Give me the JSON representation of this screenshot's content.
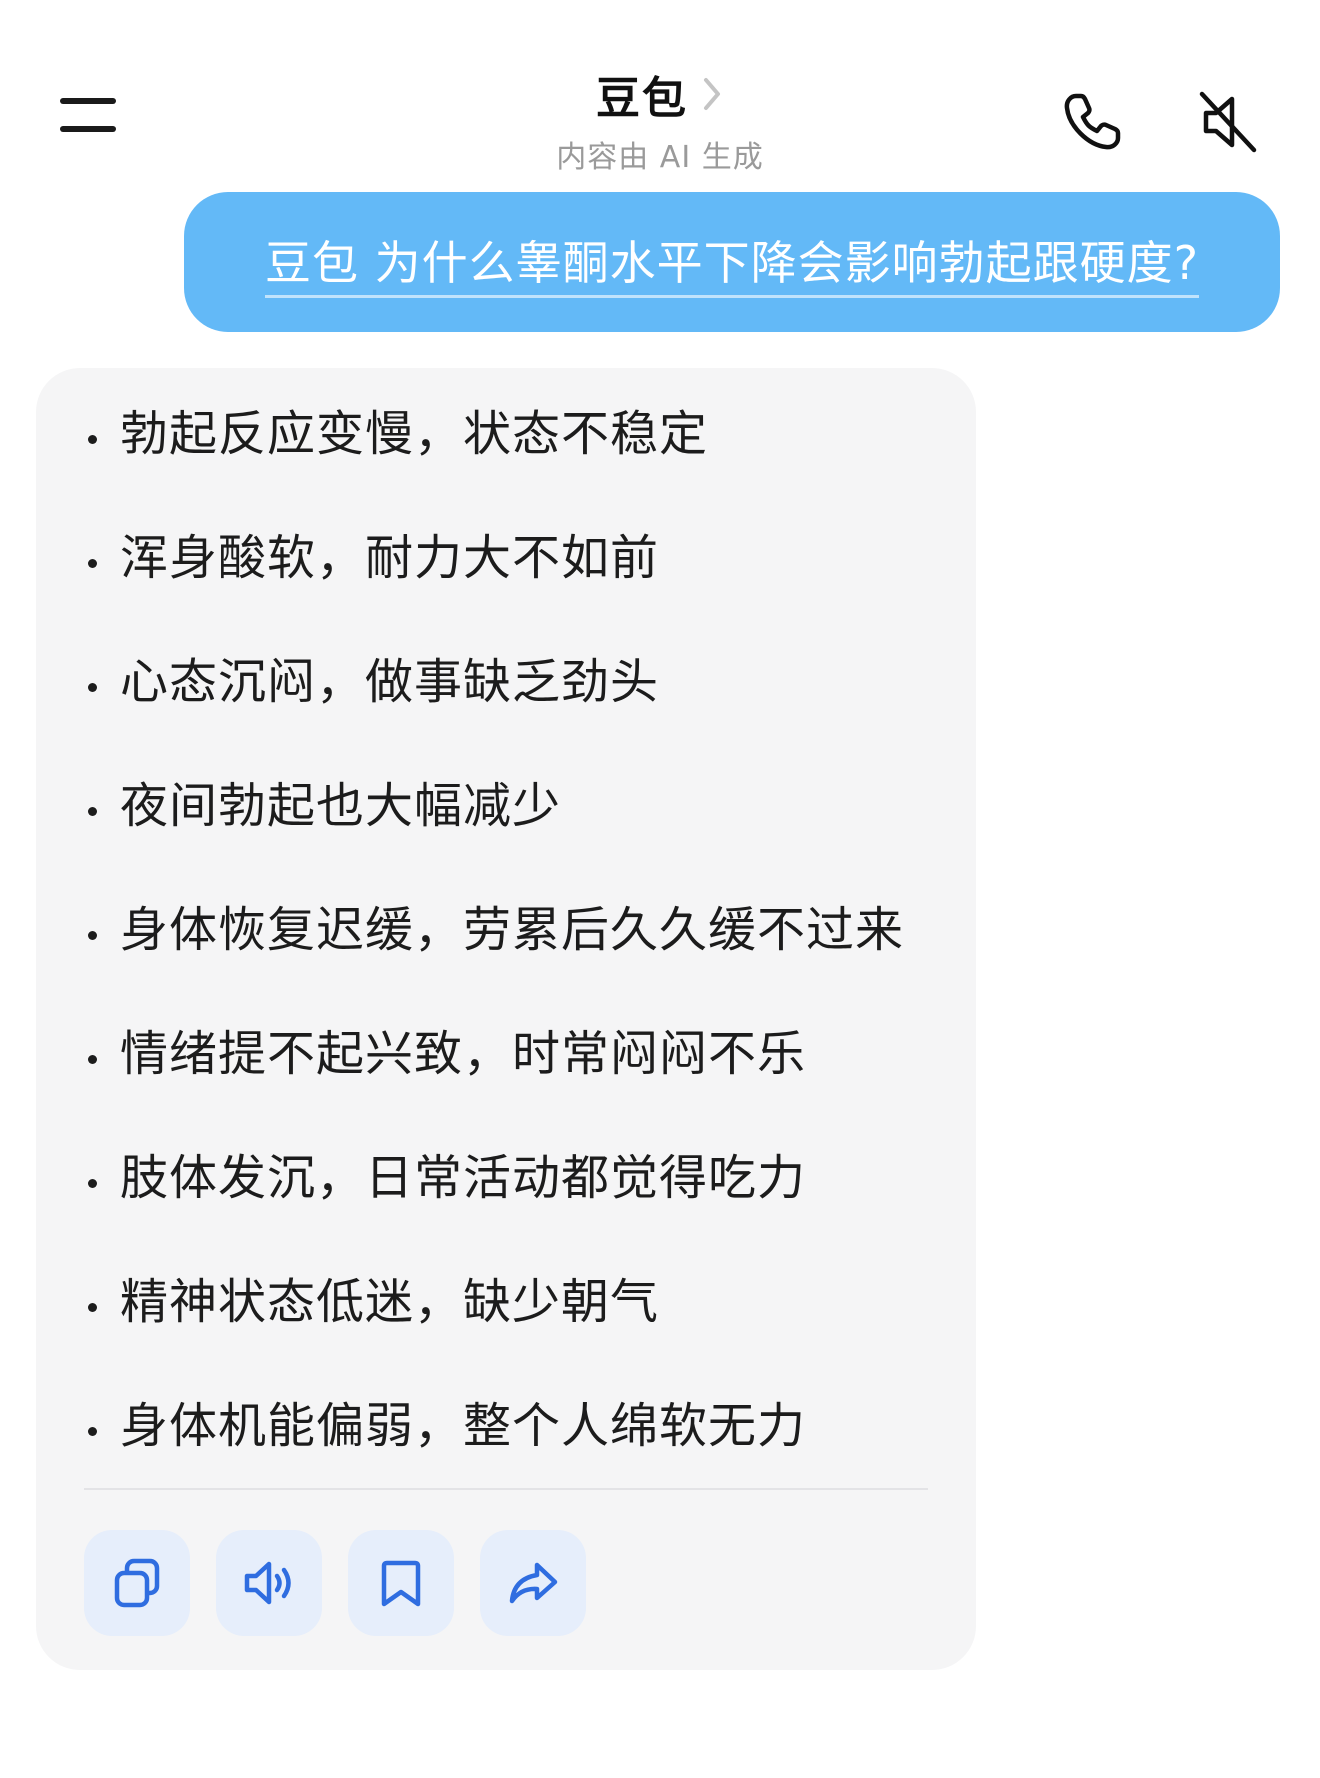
{
  "header": {
    "title": "豆包",
    "subtitle": "内容由 AI 生成",
    "icons": {
      "menu": "menu-icon",
      "title_chevron": "chevron-right-icon",
      "phone": "phone-icon",
      "mute": "speaker-muted-icon"
    }
  },
  "user_message": {
    "text": "豆包 为什么睾酮水平下降会影响勃起跟硬度?"
  },
  "answer": {
    "items": [
      "勃起反应变慢，状态不稳定",
      "浑身酸软，耐力大不如前",
      "心态沉闷，做事缺乏劲头",
      "夜间勃起也大幅减少",
      "身体恢复迟缓，劳累后久久缓不过来",
      "情绪提不起兴致，时常闷闷不乐",
      "肢体发沉，日常活动都觉得吃力",
      "精神状态低迷，缺少朝气",
      "身体机能偏弱，整个人绵软无力"
    ],
    "actions": [
      {
        "name": "copy",
        "icon": "copy-icon"
      },
      {
        "name": "read-aloud",
        "icon": "speaker-icon"
      },
      {
        "name": "bookmark",
        "icon": "bookmark-icon"
      },
      {
        "name": "share",
        "icon": "share-icon"
      }
    ]
  },
  "colors": {
    "user_bubble": "#63b9f7",
    "card_background": "#f5f5f6",
    "action_background": "#e6eefb",
    "action_icon": "#2f6de0",
    "subtitle": "#9a9a9a"
  }
}
